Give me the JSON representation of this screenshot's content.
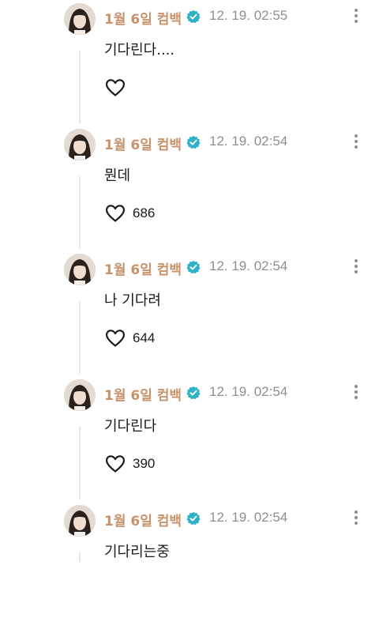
{
  "posts": [
    {
      "author": "1월 6일 컴백",
      "time": "12. 19. 02:55",
      "text": "기다린다....",
      "likes": "",
      "avatar": "avatar-icon",
      "verified_badge": "check-badge-icon"
    },
    {
      "author": "1월 6일 컴백",
      "time": "12. 19. 02:54",
      "text": "뭔데",
      "likes": "686",
      "avatar": "avatar-icon",
      "verified_badge": "check-badge-icon"
    },
    {
      "author": "1월 6일 컴백",
      "time": "12. 19. 02:54",
      "text": "나 기다려",
      "likes": "644",
      "avatar": "avatar-icon",
      "verified_badge": "check-badge-icon"
    },
    {
      "author": "1월 6일 컴백",
      "time": "12. 19. 02:54",
      "text": "기다린다",
      "likes": "390",
      "avatar": "avatar-icon",
      "verified_badge": "check-badge-icon"
    },
    {
      "author": "1월 6일 컴백",
      "time": "12. 19. 02:54",
      "text": "기다리는중",
      "likes": "",
      "avatar": "avatar-icon",
      "verified_badge": "check-badge-icon"
    }
  ],
  "colors": {
    "author": "#c8926a",
    "time": "#8f8f8f",
    "badge": "#2fb2c8",
    "thread_line": "#e6e6e6"
  }
}
